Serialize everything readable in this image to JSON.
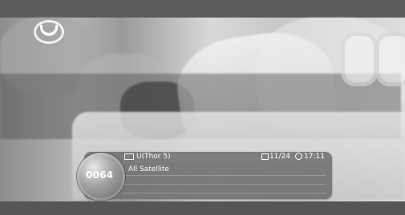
{
  "channel": {
    "number": "0064",
    "name": "U(Thor 5)",
    "group": "All Satellite"
  },
  "status": {
    "date": "11/24",
    "time": "17:11"
  },
  "icons": {
    "logo": "channel-logo",
    "satellite": "satellite-icon",
    "calendar": "calendar-icon",
    "clock": "clock-icon"
  },
  "colors": {
    "overlay_text": "#ffffff",
    "panel": "#5a5a5a"
  }
}
